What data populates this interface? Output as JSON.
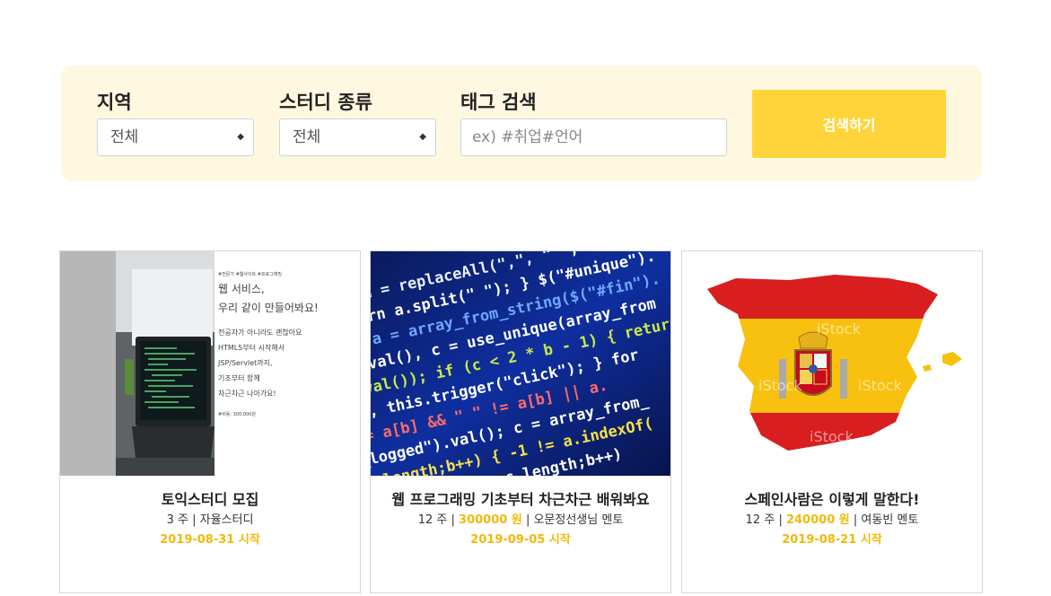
{
  "search": {
    "region_label": "지역",
    "region_value": "전체",
    "type_label": "스터디 종류",
    "type_value": "전체",
    "tag_label": "태그 검색",
    "tag_placeholder": "ex) #취업#언어",
    "button_label": "검색하기"
  },
  "cards": [
    {
      "title": "토익스터디 모집",
      "weeks": "3 주",
      "price": "",
      "sep": "|",
      "leader": "자율스터디",
      "start": "2019-08-31 시작",
      "image_text": [
        "#전문가 #웹사이트 #프로그래밍",
        "웹 서비스,",
        "우리 같이 만들어봐요!",
        "전공자가 아니라도 괜찮아요",
        "HTML5부터 시작해서",
        "JSP/Servlet까지,",
        "기초부터 함께",
        "차근차근 나아가요!",
        "#비용: 300,000원"
      ]
    },
    {
      "title": "웹 프로그래밍 기초부터 차근차근 배워봐요",
      "weeks": "12 주",
      "price": "300000 원",
      "sep": "|",
      "leader": "오문정선생님 멘토",
      "start": "2019-09-05 시작"
    },
    {
      "title": "스페인사람은 이렇게 말한다!",
      "weeks": "12 주",
      "price": "240000 원",
      "sep": "|",
      "leader": "여동빈 멘토",
      "start": "2019-08-21 시작",
      "watermark": "iStock"
    }
  ]
}
